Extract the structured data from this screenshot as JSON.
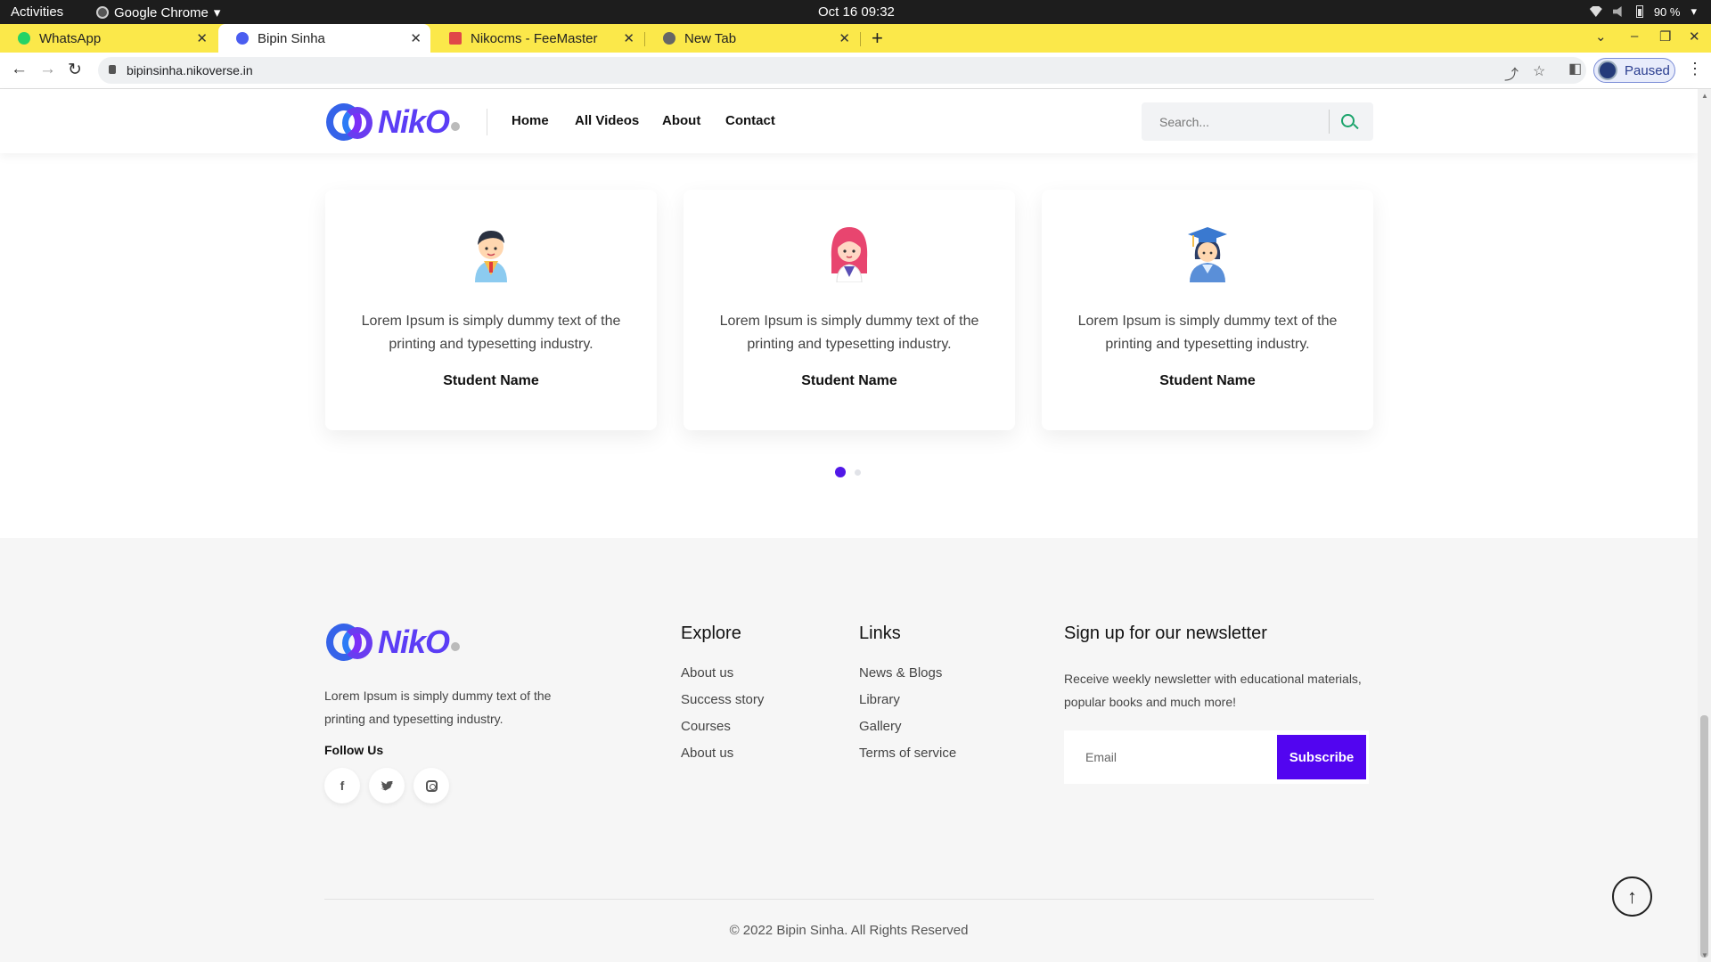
{
  "system_bar": {
    "activities": "Activities",
    "app_name": "Google Chrome",
    "clock": "Oct 16  09:32",
    "battery": "90 %"
  },
  "browser": {
    "tabs": [
      {
        "title": "WhatsApp",
        "favicon_color": "#25d366"
      },
      {
        "title": "Bipin Sinha",
        "favicon_color": "#4a5df0"
      },
      {
        "title": "Nikocms - FeeMaster",
        "favicon_color": "#e04848"
      },
      {
        "title": "New Tab",
        "favicon_color": "#666666"
      }
    ],
    "url": "bipinsinha.nikoverse.in",
    "profile_status": "Paused"
  },
  "header": {
    "logo_text": "NikO",
    "nav": [
      "Home",
      "All Videos",
      "About",
      "Contact"
    ],
    "search_placeholder": "Search..."
  },
  "testimonials": {
    "cards": [
      {
        "avatar": "boy-student-icon",
        "text": "Lorem Ipsum is simply dummy text of the printing and typesetting industry.",
        "name": "Student Name"
      },
      {
        "avatar": "girl-student-icon",
        "text": "Lorem Ipsum is simply dummy text of the printing and typesetting industry.",
        "name": "Student Name"
      },
      {
        "avatar": "graduate-student-icon",
        "text": "Lorem Ipsum is simply dummy text of the printing and typesetting industry.",
        "name": "Student Name"
      }
    ],
    "pagination": {
      "pages": 2,
      "active": 1
    }
  },
  "footer": {
    "logo_text": "NikO",
    "description": "Lorem Ipsum is simply dummy text of the printing and typesetting industry.",
    "follow_label": "Follow Us",
    "explore": {
      "heading": "Explore",
      "links": [
        "About us",
        "Success story",
        "Courses",
        "About us"
      ]
    },
    "links": {
      "heading": "Links",
      "links": [
        "News & Blogs",
        "Library",
        "Gallery",
        "Terms of service"
      ]
    },
    "newsletter": {
      "heading": "Sign up for our newsletter",
      "text": "Receive weekly newsletter with educational materials, popular books and much more!",
      "email_placeholder": "Email",
      "button": "Subscribe"
    },
    "copyright": "© 2022 Bipin Sinha. All Rights Reserved"
  },
  "colors": {
    "tabstrip": "#fbe84a",
    "accent": "#5205f0",
    "search_icon": "#1aa36b"
  }
}
